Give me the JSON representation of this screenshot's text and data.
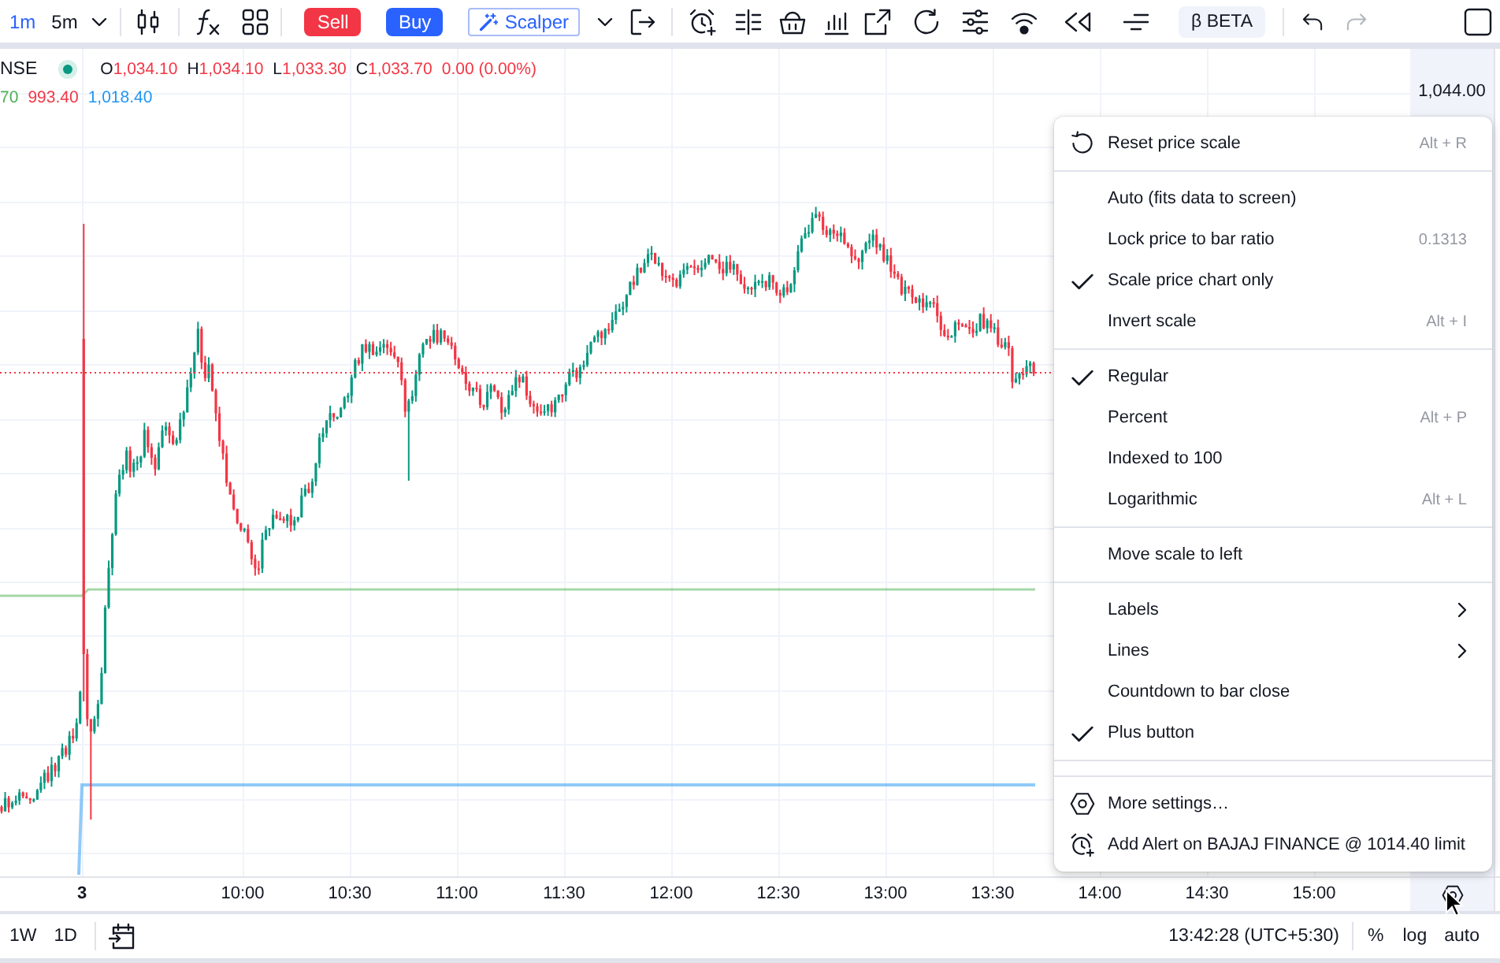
{
  "toolbar": {
    "timeframes": [
      {
        "label": "1m",
        "selected": true
      },
      {
        "label": "5m",
        "selected": false
      }
    ],
    "sell_button": "Sell",
    "buy_button": "Buy",
    "scalper_button": "Scalper",
    "beta_badge": "β BETA",
    "history": [
      {
        "disabled": false
      },
      {
        "disabled": true
      }
    ]
  },
  "legend": {
    "symbol": "NSE",
    "ohlc": [
      {
        "key": "O",
        "value": "1,034.10"
      },
      {
        "key": "H",
        "value": "1,034.10"
      },
      {
        "key": "L",
        "value": "1,033.30"
      },
      {
        "key": "C",
        "value": "1,033.70"
      }
    ],
    "change": "0.00 (0.00%)",
    "indicator_values": [
      {
        "value": "70",
        "color": "#4caf50"
      },
      {
        "value": "993.40",
        "color": "#f23645"
      },
      {
        "value": "1,018.40",
        "color": "#2196f3"
      }
    ]
  },
  "chart": {
    "price_label": "1,044.00",
    "time_labels": [
      {
        "text": "3",
        "kind": "day"
      },
      {
        "text": "10:00",
        "kind": "time"
      },
      {
        "text": "10:30",
        "kind": "time"
      },
      {
        "text": "11:00",
        "kind": "time"
      },
      {
        "text": "11:30",
        "kind": "time"
      },
      {
        "text": "12:00",
        "kind": "time"
      },
      {
        "text": "12:30",
        "kind": "time"
      },
      {
        "text": "13:00",
        "kind": "time"
      },
      {
        "text": "13:30",
        "kind": "time"
      },
      {
        "text": "14:00",
        "kind": "time"
      },
      {
        "text": "14:30",
        "kind": "time"
      },
      {
        "text": "15:00",
        "kind": "time"
      }
    ]
  },
  "price_scale_menu": {
    "sections": [
      {
        "items": [
          {
            "kind": "reset",
            "label": "Reset price scale",
            "shortcut": "Alt + R"
          }
        ]
      },
      {
        "items": [
          {
            "kind": "option",
            "label": "Auto (fits data to screen)",
            "checked": false
          },
          {
            "kind": "option",
            "label": "Lock price to bar ratio",
            "shortcut": "0.1313",
            "checked": false
          },
          {
            "kind": "option",
            "label": "Scale price chart only",
            "checked": true
          },
          {
            "kind": "option",
            "label": "Invert scale",
            "shortcut": "Alt + I",
            "checked": false
          }
        ]
      },
      {
        "items": [
          {
            "kind": "option",
            "label": "Regular",
            "checked": true
          },
          {
            "kind": "option",
            "label": "Percent",
            "shortcut": "Alt + P",
            "checked": false
          },
          {
            "kind": "option",
            "label": "Indexed to 100",
            "checked": false
          },
          {
            "kind": "option",
            "label": "Logarithmic",
            "shortcut": "Alt + L",
            "checked": false
          }
        ]
      },
      {
        "items": [
          {
            "kind": "action",
            "label": "Move scale to left"
          }
        ]
      },
      {
        "items": [
          {
            "kind": "submenu",
            "label": "Labels",
            "checked": false
          },
          {
            "kind": "submenu",
            "label": "Lines",
            "checked": false
          },
          {
            "kind": "option",
            "label": "Countdown to bar close",
            "checked": false
          },
          {
            "kind": "option",
            "label": "Plus button",
            "checked": true
          }
        ]
      },
      {
        "items": [
          {
            "kind": "settings",
            "label": "More settings…"
          },
          {
            "kind": "alert",
            "label": "Add Alert on BAJAJ FINANCE @ 1014.40 limit"
          }
        ]
      }
    ]
  },
  "bottom_bar": {
    "ranges": [
      "1W",
      "1D"
    ],
    "clock": "13:42:28 (UTC+5:30)",
    "scale_buttons": [
      "%",
      "log",
      "auto"
    ]
  }
}
